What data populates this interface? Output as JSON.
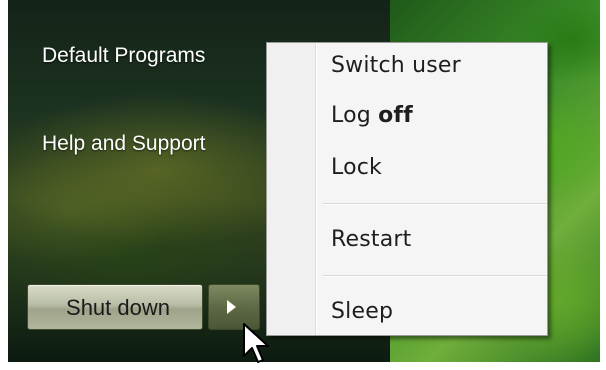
{
  "start_menu": {
    "links": {
      "default_programs": "Default Programs",
      "help_and_support": "Help and Support"
    },
    "shutdown_label": "Shut down"
  },
  "power_menu": {
    "items": [
      {
        "label": "Switch user"
      },
      {
        "label_prefix": "Log ",
        "label_bold": "off"
      },
      {
        "label": "Lock"
      },
      {
        "label": "Restart"
      },
      {
        "label": "Sleep"
      }
    ]
  },
  "icons": {
    "arrow": "arrow-right-icon",
    "cursor": "mouse-pointer-icon"
  }
}
